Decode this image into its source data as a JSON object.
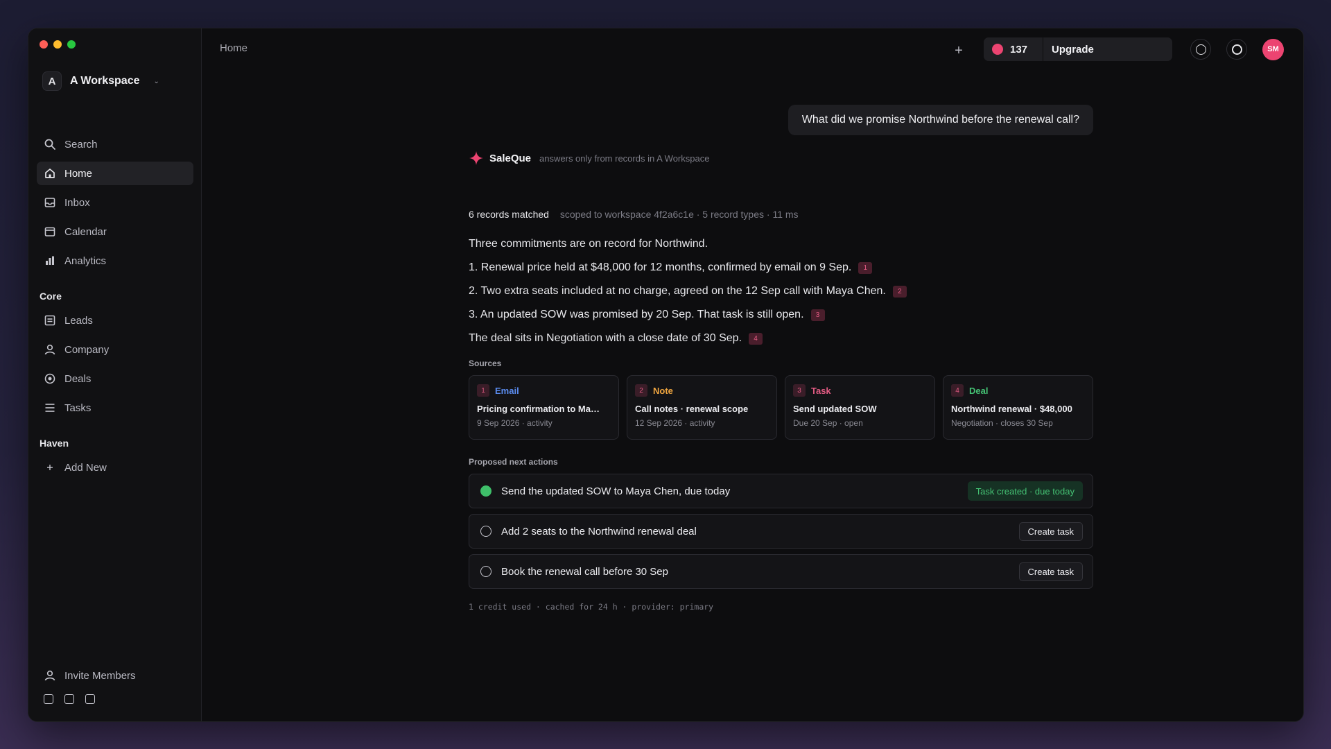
{
  "workspace": {
    "initial": "A",
    "name": "A Workspace"
  },
  "sidebar": {
    "search_label": "Search",
    "primary": [
      {
        "label": "Home",
        "icon": "home-icon",
        "active": true
      },
      {
        "label": "Inbox",
        "icon": "inbox-icon"
      },
      {
        "label": "Calendar",
        "icon": "calendar-icon"
      },
      {
        "label": "Analytics",
        "icon": "bar-chart-icon"
      }
    ],
    "core_label": "Core",
    "core": [
      {
        "label": "Leads",
        "icon": "list-box-icon"
      },
      {
        "label": "Company",
        "icon": "person-icon"
      },
      {
        "label": "Deals",
        "icon": "target-icon"
      },
      {
        "label": "Tasks",
        "icon": "lines-icon"
      }
    ],
    "haven_label": "Haven",
    "add_new_label": "Add New",
    "invite_label": "Invite Members"
  },
  "header": {
    "breadcrumb": "Home",
    "plus": "+",
    "credits": "137",
    "upgrade_label": "Upgrade",
    "avatar_initials": "SM"
  },
  "colors": {
    "accent": "#ec4471",
    "success": "#3fbf6a",
    "email": "#5b8cf0",
    "note": "#f0a640",
    "task": "#e25b83",
    "deal": "#45c274"
  },
  "chat": {
    "question": "What did we promise Northwind before the renewal call?",
    "assistant_name": "SaleQue",
    "assistant_scope": "answers only from records in A Workspace",
    "matched": "6 records matched",
    "meta": "scoped to workspace 4f2a6c1e · 5 record types · 11 ms",
    "answer": [
      {
        "text": "Three commitments are on record for Northwind.",
        "cite": ""
      },
      {
        "text": "1. Renewal price held at $48,000 for 12 months, confirmed by email on 9 Sep.",
        "cite": "1"
      },
      {
        "text": "2. Two extra seats included at no charge, agreed on the 12 Sep call with Maya Chen.",
        "cite": "2"
      },
      {
        "text": "3. An updated SOW was promised by 20 Sep. That task is still open.",
        "cite": "3"
      },
      {
        "text": "The deal sits in Negotiation with a close date of 30 Sep.",
        "cite": "4"
      }
    ],
    "sources_label": "Sources",
    "sources": [
      {
        "num": "1",
        "type": "Email",
        "title": "Pricing confirmation to Ma…",
        "sub": "9 Sep 2026 · activity",
        "color": "#5b8cf0"
      },
      {
        "num": "2",
        "type": "Note",
        "title": "Call notes · renewal scope",
        "sub": "12 Sep 2026 · activity",
        "color": "#f0a640"
      },
      {
        "num": "3",
        "type": "Task",
        "title": "Send updated SOW",
        "sub": "Due 20 Sep · open",
        "color": "#e25b83"
      },
      {
        "num": "4",
        "type": "Deal",
        "title": "Northwind renewal · $48,000",
        "sub": "Negotiation · closes 30 Sep",
        "color": "#45c274"
      }
    ],
    "actions_label": "Proposed next actions",
    "actions": [
      {
        "text": "Send the updated SOW to Maya Chen, due today",
        "done": true,
        "status": "Task created · due today"
      },
      {
        "text": "Add 2 seats to the Northwind renewal deal",
        "done": false,
        "button": "Create task"
      },
      {
        "text": "Book the renewal call before 30 Sep",
        "done": false,
        "button": "Create task"
      }
    ],
    "footnote": "1 credit used · cached for 24 h · provider: primary"
  }
}
